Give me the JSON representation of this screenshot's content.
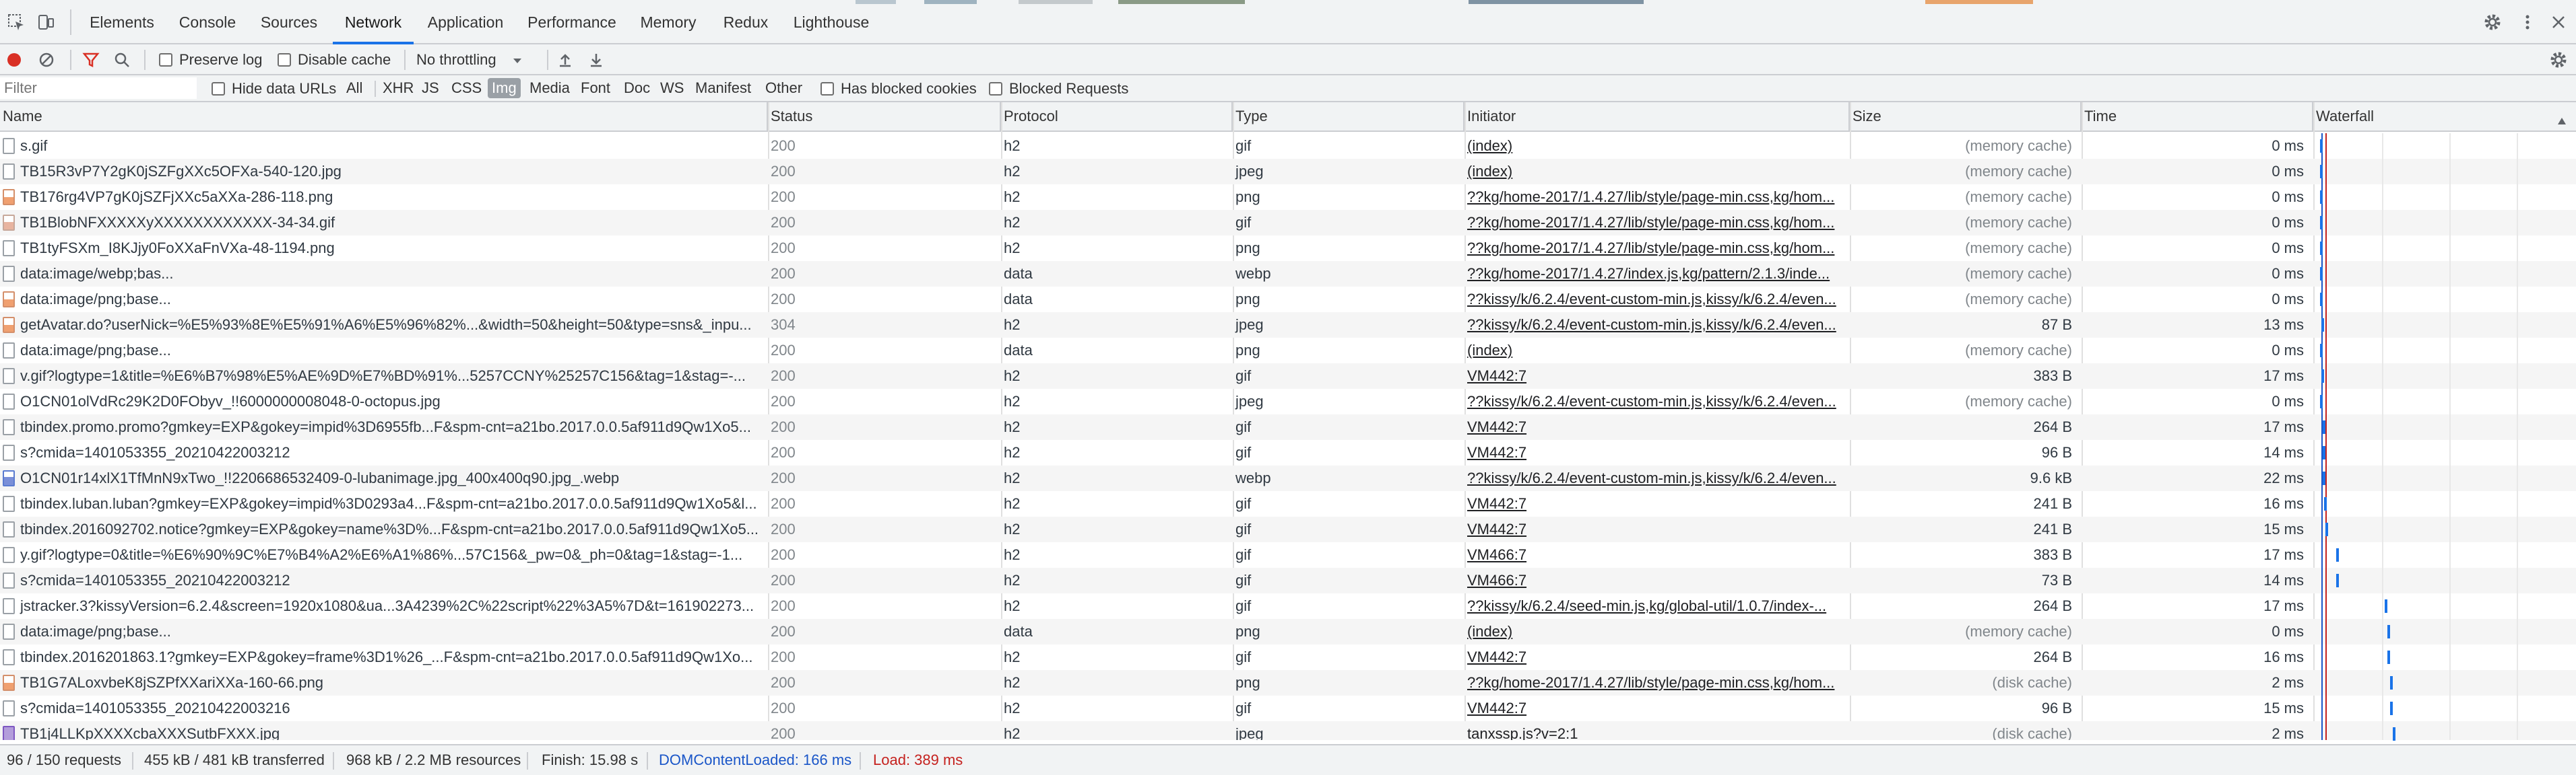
{
  "tabs": [
    {
      "label": "Elements",
      "active": false
    },
    {
      "label": "Console",
      "active": false
    },
    {
      "label": "Sources",
      "active": false
    },
    {
      "label": "Network",
      "active": true
    },
    {
      "label": "Application",
      "active": false
    },
    {
      "label": "Performance",
      "active": false
    },
    {
      "label": "Memory",
      "active": false
    },
    {
      "label": "Redux",
      "active": false
    },
    {
      "label": "Lighthouse",
      "active": false
    }
  ],
  "toolbar": {
    "preserve_log": "Preserve log",
    "disable_cache": "Disable cache",
    "throttling": "No throttling"
  },
  "filterbar": {
    "placeholder": "Filter",
    "hide_data_urls": "Hide data URLs",
    "types": [
      "All",
      "XHR",
      "JS",
      "CSS",
      "Img",
      "Media",
      "Font",
      "Doc",
      "WS",
      "Manifest",
      "Other"
    ],
    "active_type": "Img",
    "has_blocked_cookies": "Has blocked cookies",
    "blocked_requests": "Blocked Requests"
  },
  "columns": {
    "name": "Name",
    "status": "Status",
    "protocol": "Protocol",
    "type": "Type",
    "initiator": "Initiator",
    "size": "Size",
    "time": "Time",
    "waterfall": "Waterfall"
  },
  "rows": [
    {
      "name": "s.gif",
      "status": "200",
      "protocol": "h2",
      "type": "gif",
      "initiator": "(index)",
      "size": "(memory cache)",
      "time": "0 ms",
      "icon": "file"
    },
    {
      "name": "TB15R3vP7Y2gK0jSZFgXXc5OFXa-540-120.jpg",
      "status": "200",
      "protocol": "h2",
      "type": "jpeg",
      "initiator": "(index)",
      "size": "(memory cache)",
      "time": "0 ms",
      "icon": "file"
    },
    {
      "name": "TB176rg4VP7gK0jSZFjXXc5aXXa-286-118.png",
      "status": "200",
      "protocol": "h2",
      "type": "png",
      "initiator": "??kg/home-2017/1.4.27/lib/style/page-min.css,kg/hom...",
      "size": "(memory cache)",
      "time": "0 ms",
      "icon": "png"
    },
    {
      "name": "TB1BlobNFXXXXXyXXXXXXXXXXXX-34-34.gif",
      "status": "200",
      "protocol": "h2",
      "type": "gif",
      "initiator": "??kg/home-2017/1.4.27/lib/style/page-min.css,kg/hom...",
      "size": "(memory cache)",
      "time": "0 ms",
      "icon": "img"
    },
    {
      "name": "TB1tyFSXm_I8KJjy0FoXXaFnVXa-48-1194.png",
      "status": "200",
      "protocol": "h2",
      "type": "png",
      "initiator": "??kg/home-2017/1.4.27/lib/style/page-min.css,kg/hom...",
      "size": "(memory cache)",
      "time": "0 ms",
      "icon": "file"
    },
    {
      "name": "data:image/webp;bas...",
      "status": "200",
      "protocol": "data",
      "type": "webp",
      "initiator": "??kg/home-2017/1.4.27/index.js,kg/pattern/2.1.3/inde...",
      "size": "(memory cache)",
      "time": "0 ms",
      "icon": "file"
    },
    {
      "name": "data:image/png;base...",
      "status": "200",
      "protocol": "data",
      "type": "png",
      "initiator": "??kissy/k/6.2.4/event-custom-min.js,kissy/k/6.2.4/even...",
      "size": "(memory cache)",
      "time": "0 ms",
      "icon": "png"
    },
    {
      "name": "getAvatar.do?userNick=%E5%93%8E%E5%91%A6%E5%96%82%...&width=50&height=50&type=sns&_inpu...",
      "status": "304",
      "protocol": "h2",
      "type": "jpeg",
      "initiator": "??kissy/k/6.2.4/event-custom-min.js,kissy/k/6.2.4/even...",
      "size": "87 B",
      "time": "13 ms",
      "icon": "png"
    },
    {
      "name": "data:image/png;base...",
      "status": "200",
      "protocol": "data",
      "type": "png",
      "initiator": "(index)",
      "size": "(memory cache)",
      "time": "0 ms",
      "icon": "file"
    },
    {
      "name": "v.gif?logtype=1&title=%E6%B7%98%E5%AE%9D%E7%BD%91%...5257CCNY%25257C156&tag=1&stag=-...",
      "status": "200",
      "protocol": "h2",
      "type": "gif",
      "initiator": "VM442:7",
      "size": "383 B",
      "time": "17 ms",
      "icon": "file"
    },
    {
      "name": "O1CN01olVdRc29K2D0FObyv_!!6000000008048-0-octopus.jpg",
      "status": "200",
      "protocol": "h2",
      "type": "jpeg",
      "initiator": "??kissy/k/6.2.4/event-custom-min.js,kissy/k/6.2.4/even...",
      "size": "(memory cache)",
      "time": "0 ms",
      "icon": "file"
    },
    {
      "name": "tbindex.promo.promo?gmkey=EXP&gokey=impid%3D6955fb...F&spm-cnt=a21bo.2017.0.0.5af911d9Qw1Xo5...",
      "status": "200",
      "protocol": "h2",
      "type": "gif",
      "initiator": "VM442:7",
      "size": "264 B",
      "time": "17 ms",
      "icon": "file"
    },
    {
      "name": "s?cmida=1401053355_20210422003212",
      "status": "200",
      "protocol": "h2",
      "type": "gif",
      "initiator": "VM442:7",
      "size": "96 B",
      "time": "14 ms",
      "icon": "file"
    },
    {
      "name": "O1CN01r14xlX1TfMnN9xTwo_!!2206686532409-0-lubanimage.jpg_400x400q90.jpg_.webp",
      "status": "200",
      "protocol": "h2",
      "type": "webp",
      "initiator": "??kissy/k/6.2.4/event-custom-min.js,kissy/k/6.2.4/even...",
      "size": "9.6 kB",
      "time": "22 ms",
      "icon": "blue"
    },
    {
      "name": "tbindex.luban.luban?gmkey=EXP&gokey=impid%3D0293a4...F&spm-cnt=a21bo.2017.0.0.5af911d9Qw1Xo5&l...",
      "status": "200",
      "protocol": "h2",
      "type": "gif",
      "initiator": "VM442:7",
      "size": "241 B",
      "time": "16 ms",
      "icon": "file"
    },
    {
      "name": "tbindex.2016092702.notice?gmkey=EXP&gokey=name%3D%...F&spm-cnt=a21bo.2017.0.0.5af911d9Qw1Xo5...",
      "status": "200",
      "protocol": "h2",
      "type": "gif",
      "initiator": "VM442:7",
      "size": "241 B",
      "time": "15 ms",
      "icon": "file"
    },
    {
      "name": "y.gif?logtype=0&title=%E6%90%9C%E7%B4%A2%E6%A1%86%...57C156&_pw=0&_ph=0&tag=1&stag=-1...",
      "status": "200",
      "protocol": "h2",
      "type": "gif",
      "initiator": "VM466:7",
      "size": "383 B",
      "time": "17 ms",
      "icon": "file"
    },
    {
      "name": "s?cmida=1401053355_20210422003212",
      "status": "200",
      "protocol": "h2",
      "type": "gif",
      "initiator": "VM466:7",
      "size": "73 B",
      "time": "14 ms",
      "icon": "file"
    },
    {
      "name": "jstracker.3?kissyVersion=6.2.4&screen=1920x1080&ua...3A4239%2C%22script%22%3A5%7D&t=161902273...",
      "status": "200",
      "protocol": "h2",
      "type": "gif",
      "initiator": "??kissy/k/6.2.4/seed-min.js,kg/global-util/1.0.7/index-...",
      "size": "264 B",
      "time": "17 ms",
      "icon": "file"
    },
    {
      "name": "data:image/png;base...",
      "status": "200",
      "protocol": "data",
      "type": "png",
      "initiator": "(index)",
      "size": "(memory cache)",
      "time": "0 ms",
      "icon": "file"
    },
    {
      "name": "tbindex.2016201863.1?gmkey=EXP&gokey=frame%3D1%26_...F&spm-cnt=a21bo.2017.0.0.5af911d9Qw1Xo...",
      "status": "200",
      "protocol": "h2",
      "type": "gif",
      "initiator": "VM442:7",
      "size": "264 B",
      "time": "16 ms",
      "icon": "file"
    },
    {
      "name": "TB1G7ALoxvbeK8jSZPfXXariXXa-160-66.png",
      "status": "200",
      "protocol": "h2",
      "type": "png",
      "initiator": "??kg/home-2017/1.4.27/lib/style/page-min.css,kg/hom...",
      "size": "(disk cache)",
      "time": "2 ms",
      "icon": "png"
    },
    {
      "name": "s?cmida=1401053355_20210422003216",
      "status": "200",
      "protocol": "h2",
      "type": "gif",
      "initiator": "VM442:7",
      "size": "96 B",
      "time": "15 ms",
      "icon": "file"
    },
    {
      "name": "TB1j4LLKpXXXXcbaXXXSutbFXXX.jpg",
      "status": "200",
      "protocol": "h2",
      "type": "jpeg",
      "initiator": "tanxssp.js?v=2:1",
      "size": "(disk cache)",
      "time": "2 ms",
      "icon": "purple"
    }
  ],
  "status_bar": {
    "requests": "96 / 150 requests",
    "transferred": "455 kB / 481 kB transferred",
    "resources": "968 kB / 2.2 MB resources",
    "finish": "Finish: 15.98 s",
    "dom_content_loaded": "DOMContentLoaded: 166 ms",
    "load": "Load: 389 ms"
  },
  "colors": {
    "accent": "#1a73e8",
    "record": "#d93025",
    "filter_active": "#d93025",
    "dom_content_loaded": "#1a56c8",
    "load": "#c5221f",
    "waterfall_bar": "#1a73e8"
  }
}
